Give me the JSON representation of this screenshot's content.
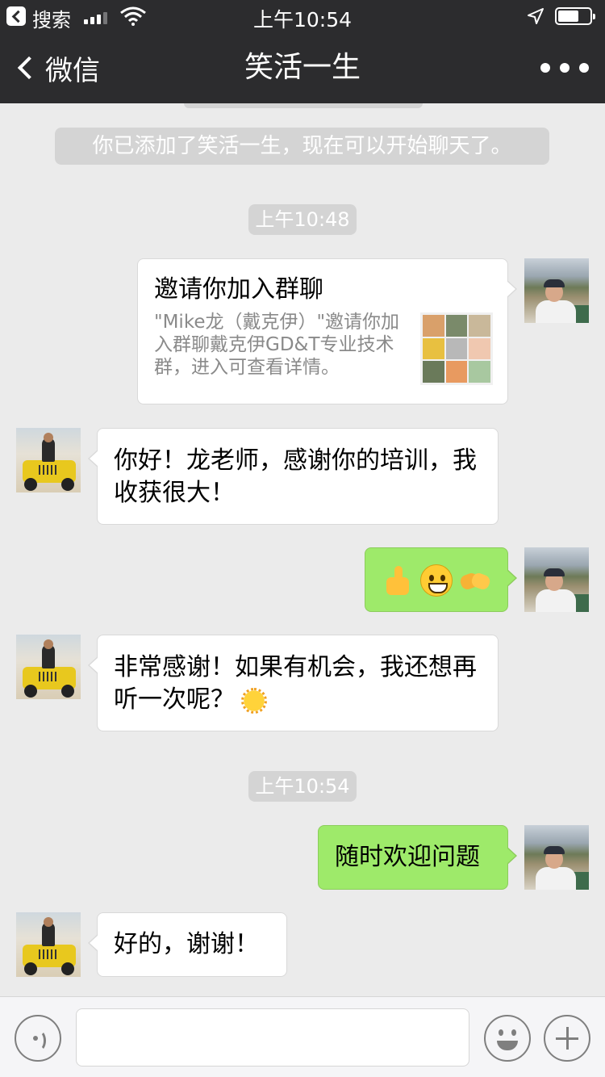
{
  "status_bar": {
    "back_app": "搜索",
    "time": "上午10:54",
    "signal_bars_filled": 3,
    "signal_bars_total": 4,
    "battery_level": 0.6
  },
  "nav": {
    "back_label": "微信",
    "title": "笑活一生"
  },
  "chat": {
    "system_notice": "你已添加了笑活一生，现在可以开始聊天了。",
    "timestamp_1": "上午10:48",
    "invite": {
      "title": "邀请你加入群聊",
      "description": "\"Mike龙（戴克伊）\"邀请你加入群聊戴克伊GD&T专业技术群，进入可查看详情。"
    },
    "msg_1": "你好！龙老师，感谢你的培训，我收获很大！",
    "msg_2_emojis": [
      "thumbs-up",
      "grinning-face",
      "handshake"
    ],
    "msg_3": "非常感谢！如果有机会，我还想再听一次呢？",
    "msg_3_emoji": "sun-with-face",
    "timestamp_2": "上午10:54",
    "msg_4": "随时欢迎问题",
    "msg_5": "好的，谢谢！"
  },
  "input_bar": {
    "value": ""
  },
  "colors": {
    "nav_background": "#2c2c2e",
    "chat_background": "#ebebeb",
    "own_bubble": "#9eea6a",
    "other_bubble": "#ffffff"
  }
}
